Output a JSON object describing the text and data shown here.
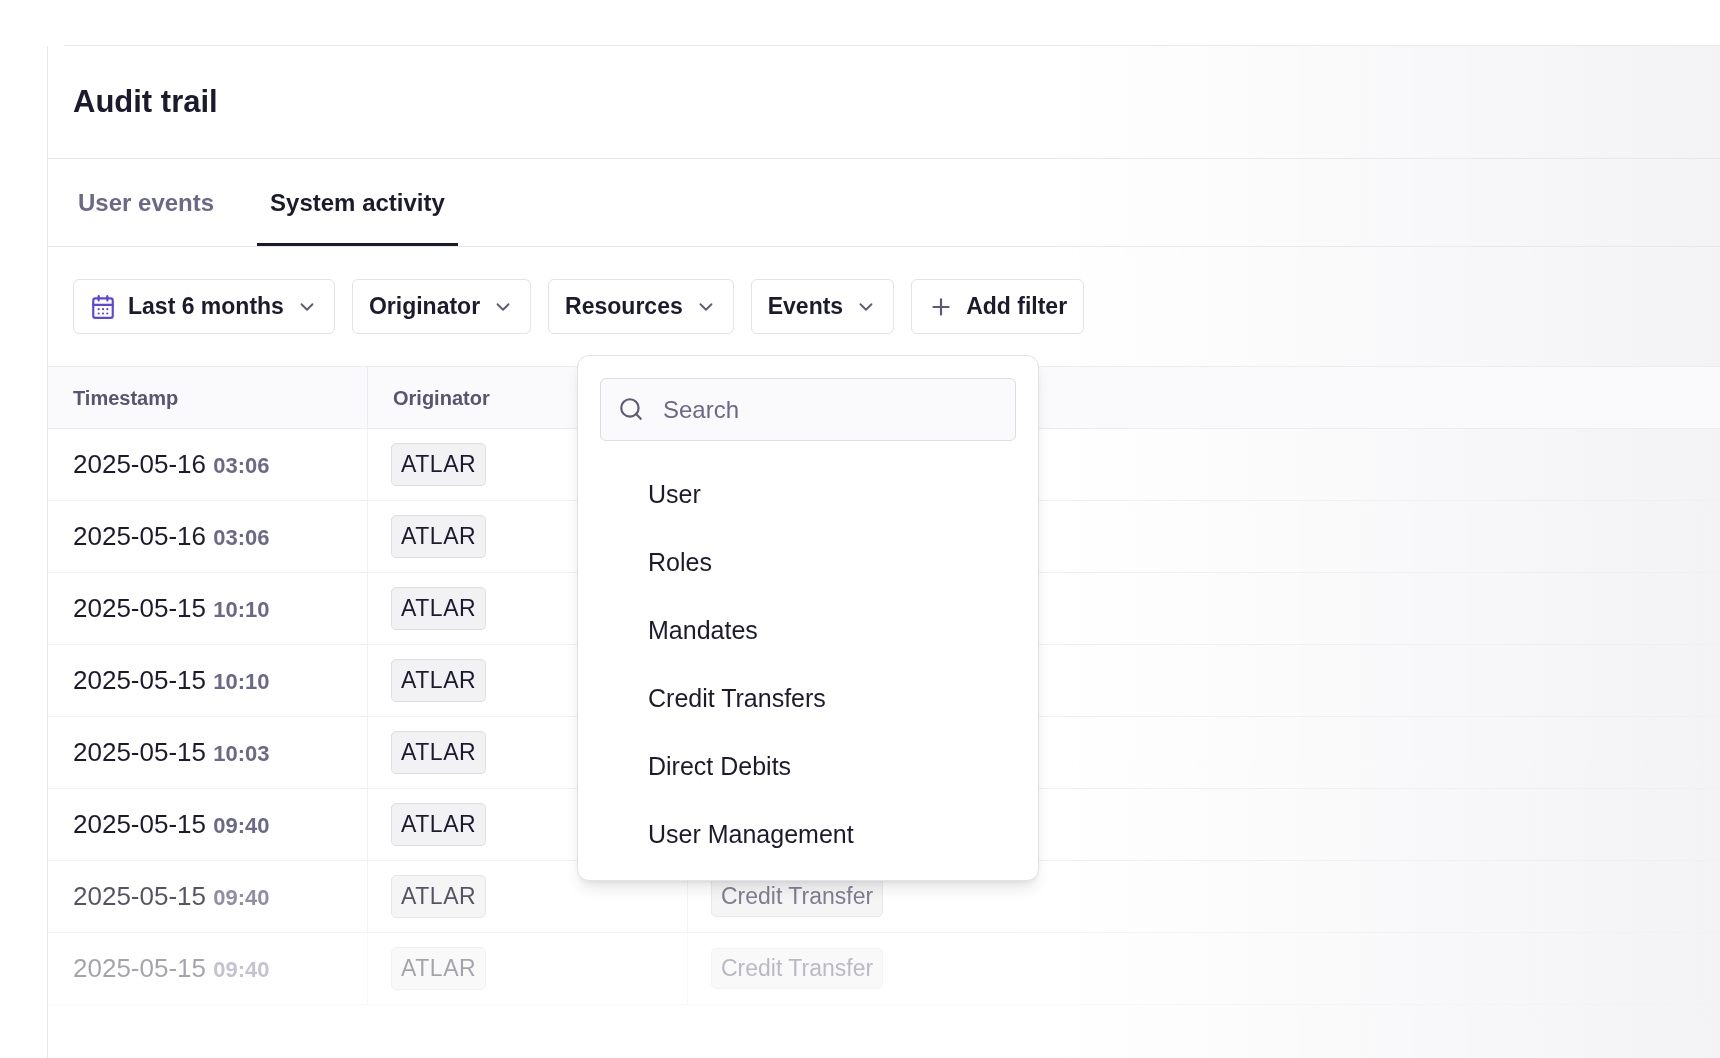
{
  "page": {
    "title": "Audit trail"
  },
  "tabs": [
    {
      "label": "User events",
      "selected": false
    },
    {
      "label": "System activity",
      "selected": true
    }
  ],
  "filters": [
    {
      "label": "Last 6 months",
      "kind": "date"
    },
    {
      "label": "Originator",
      "kind": "dropdown"
    },
    {
      "label": "Resources",
      "kind": "dropdown"
    },
    {
      "label": "Events",
      "kind": "dropdown"
    },
    {
      "label": "Add filter",
      "kind": "add"
    }
  ],
  "table": {
    "columns": [
      "Timestamp",
      "Originator"
    ],
    "rows": [
      {
        "date": "2025-05-16",
        "time": "03:06",
        "originator": "ATLAR"
      },
      {
        "date": "2025-05-16",
        "time": "03:06",
        "originator": "ATLAR"
      },
      {
        "date": "2025-05-15",
        "time": "10:10",
        "originator": "ATLAR"
      },
      {
        "date": "2025-05-15",
        "time": "10:10",
        "originator": "ATLAR"
      },
      {
        "date": "2025-05-15",
        "time": "10:03",
        "originator": "ATLAR"
      },
      {
        "date": "2025-05-15",
        "time": "09:40",
        "originator": "ATLAR"
      },
      {
        "date": "2025-05-15",
        "time": "09:40",
        "originator": "ATLAR",
        "resource": "Credit Transfer"
      },
      {
        "date": "2025-05-15",
        "time": "09:40",
        "originator": "ATLAR",
        "resource": "Credit Transfer"
      }
    ]
  },
  "resources_menu": {
    "search": {
      "placeholder": "Search"
    },
    "items": [
      "User",
      "Roles",
      "Mandates",
      "Credit Transfers",
      "Direct Debits",
      "User Management"
    ]
  }
}
